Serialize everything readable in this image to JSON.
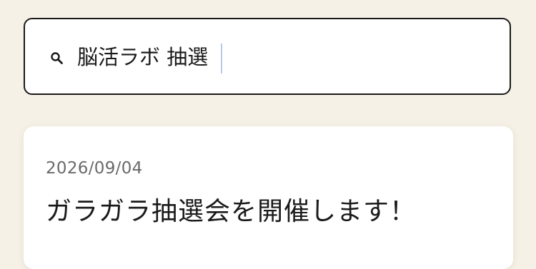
{
  "search": {
    "value": "脳活ラボ 抽選",
    "icon": "search-icon"
  },
  "results": [
    {
      "date": "2026/09/04",
      "title": "ガラガラ抽選会を開催します！"
    }
  ],
  "colors": {
    "background": "#f6f1e7",
    "card": "#ffffff",
    "border": "#1a1a1a",
    "text": "#1a1a1a",
    "muted_text": "#6a6a6a",
    "caret": "#b8c8e8"
  }
}
